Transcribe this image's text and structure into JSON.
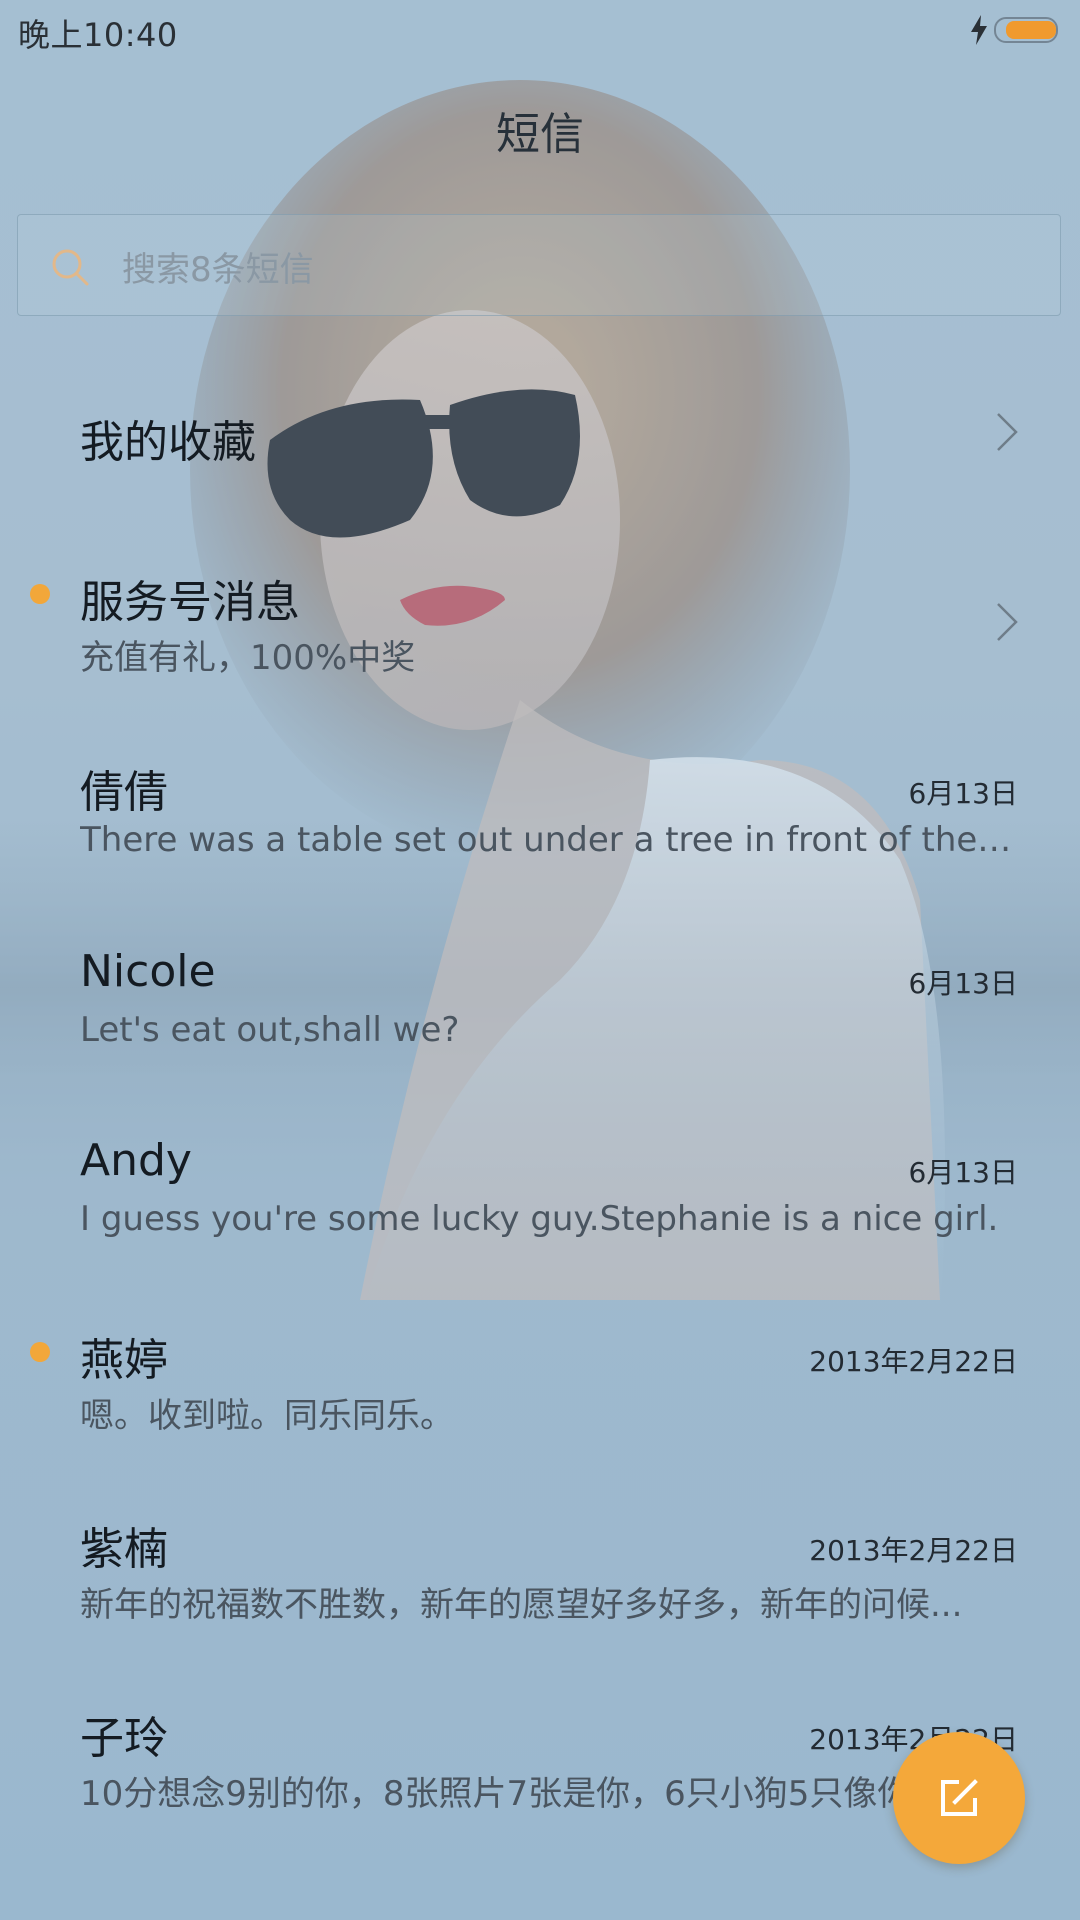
{
  "status_bar": {
    "time": "晚上10:40",
    "icons": [
      "charging-icon",
      "battery-icon"
    ]
  },
  "header": {
    "title": "短信"
  },
  "search": {
    "placeholder": "搜索8条短信"
  },
  "rows": [
    {
      "title": "我的收藏",
      "subtitle": "",
      "date": "",
      "unread": false,
      "chevron": true
    },
    {
      "title": "服务号消息",
      "subtitle": "充值有礼，100%中奖",
      "date": "",
      "unread": true,
      "chevron": true
    },
    {
      "title": "倩倩",
      "subtitle": "There was a table set out under a tree in front of the ho...",
      "date": "6月13日",
      "unread": false,
      "chevron": false
    },
    {
      "title": "Nicole",
      "subtitle": "Let's eat out,shall we?",
      "date": "6月13日",
      "unread": false,
      "chevron": false
    },
    {
      "title": "Andy",
      "subtitle": "I guess you're some lucky guy.Stephanie is a nice girl.",
      "date": "6月13日",
      "unread": false,
      "chevron": false
    },
    {
      "title": "燕婷",
      "subtitle": "嗯。收到啦。同乐同乐。",
      "date": "2013年2月22日",
      "unread": true,
      "chevron": false
    },
    {
      "title": "紫楠",
      "subtitle": "新年的祝福数不胜数，新年的愿望好多好多，新年的问候...",
      "date": "2013年2月22日",
      "unread": false,
      "chevron": false
    },
    {
      "title": "子玲",
      "subtitle": "10分想念9别的你，8张照片7张是你，6只小狗5只像你",
      "date": "2013年2月22日",
      "unread": false,
      "chevron": false
    }
  ],
  "fab": {
    "icon": "compose-icon"
  },
  "colors": {
    "accent": "#f4a83a",
    "unread_dot": "#f2a73a",
    "background": "#a8c0d2"
  }
}
